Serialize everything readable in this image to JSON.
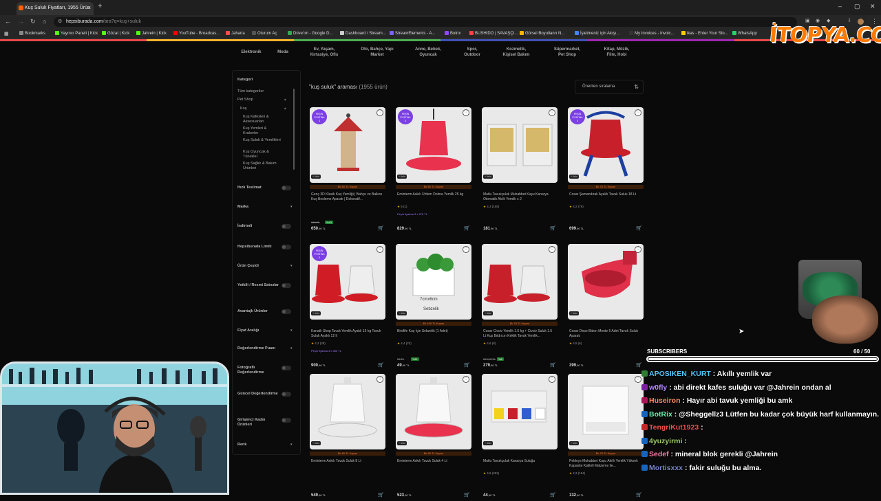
{
  "browser": {
    "tab_title": "Kuş Suluk Fiyatları, 1955 Ürün",
    "url_host": "hepsiburada.com",
    "url_path": "/ara?q=kuş+suluk",
    "bookmarks": [
      "Bookmarks",
      "Yayıncı Paneli | Kick",
      "Gözat | Kick",
      "Jahrein | Kick",
      "YouTube - Broadcas...",
      "Jaharia",
      "Oturum Aç",
      "Drive'ım - Google D...",
      "Dashboard / Stream...",
      "StreamElements - A...",
      "Botrix",
      "BUSHIDO | SAVAŞÇI...",
      "Görsel Boyutlanrı N...",
      "İşletmeniz için Akışı...",
      "My Invoices - Invoic...",
      "ikas - Enter Your Sto...",
      "WhatsApp"
    ]
  },
  "overlay": {
    "logo": "İTOPYA.COM"
  },
  "categories": [
    {
      "l1": "Elektronik",
      "l2": ""
    },
    {
      "l1": "Moda",
      "l2": ""
    },
    {
      "l1": "Ev, Yaşam,",
      "l2": "Kırtasiye, Ofis"
    },
    {
      "l1": "Oto, Bahçe, Yapı",
      "l2": "Market"
    },
    {
      "l1": "Anne, Bebek,",
      "l2": "Oyuncak"
    },
    {
      "l1": "Spor,",
      "l2": "Outdoor"
    },
    {
      "l1": "Kozmetik,",
      "l2": "Kişisel Bakım"
    },
    {
      "l1": "Süpermarket,",
      "l2": "Pet Shop"
    },
    {
      "l1": "Kitap, Müzik,",
      "l2": "Film, Hobi"
    }
  ],
  "sidebar": {
    "kategori": "Kategori",
    "tum": "Tüm kategoriler",
    "petshop": "Pet Shop",
    "kus": "Kuş",
    "sub": [
      "Kuş Kafesleri & Aksesuarları",
      "Kuş Yemleri & Krakerler",
      "Kuş Suluk & Yemlikleri",
      "Kuş Oyuncak & Tüneklel",
      "Kuş Sağlık & Bakım Ürünleri"
    ],
    "filters": [
      {
        "label": "Hızlı Teslimat",
        "type": "toggle"
      },
      {
        "label": "Marka",
        "type": "chev"
      },
      {
        "label": "İndirimli",
        "type": "toggle"
      },
      {
        "label": "Hepsiburada Limiti",
        "type": "toggle"
      },
      {
        "label": "Ürün Çeşidi",
        "type": "chev"
      },
      {
        "label": "Yetkili / Resmi Satıcılar",
        "type": "toggle"
      },
      {
        "label": "Avantajlı Ürünler",
        "type": "toggle"
      },
      {
        "label": "Fiyat Aralığı",
        "type": "chev"
      },
      {
        "label": "Değerlendirme Puanı",
        "type": "chev"
      },
      {
        "label": "Fotoğraflı Değerlendirme",
        "type": "toggle"
      },
      {
        "label": "Güncel Değerlendirme",
        "type": "toggle"
      },
      {
        "label": "Girişimci Kadın Ürünleri",
        "type": "toggle"
      },
      {
        "label": "Renk",
        "type": "chev"
      }
    ]
  },
  "results": {
    "query_title": "\"kuş suluk\" araması",
    "count": "(1955 ürün)",
    "sort_label": "Önerilen sıralama"
  },
  "products": [
    {
      "ribbon": true,
      "kupon": "Ek 50 TL Kupon",
      "name": "Genç 3D Klasik Kuş Yemliği | Bahçe ve Balkon Kuş Besleme Aparatı | Dekoratif...",
      "rating": "",
      "promo": "",
      "old": "769 TL",
      "disc": "%43",
      "price": "650",
      "color": "#c03030"
    },
    {
      "ribbon": true,
      "kupon": "Ek 60 TL Kupon",
      "name": "Eminterm Askılı Ürtlem Dolma Yemlik 25 kg",
      "rating": "5 (1)",
      "promo": "Peşin fiyatına 3 x 276 TL",
      "old": "",
      "disc": "",
      "price": "829",
      "color": "#e8324e"
    },
    {
      "ribbon": false,
      "kupon": "",
      "name": "Mutlu Tavukçuluk Muhabbet Kuşu Kanarya Otomatik Akıllı Yemlik x 2",
      "rating": "4,3 (158)",
      "promo": "",
      "old": "",
      "disc": "",
      "price": "181",
      "color": "#d8c28a"
    },
    {
      "ribbon": true,
      "kupon": "Ek 75 TL Kupon",
      "name": "Cosar Şamandıralı Ayaklı Tavuk Suluk 18 Lt",
      "rating": "4,2 (78)",
      "promo": "",
      "old": "",
      "disc": "",
      "price": "699",
      "color": "#c8202a"
    },
    {
      "ribbon": true,
      "kupon": "",
      "name": "Kanatlı Shop Tavuk Yemlik Ayaklı 15 kg Tavuk Suluk Ayaklı 12 lt",
      "rating": "4,3 (28)",
      "promo": "Peşin fiyatına 3 x 300 TL",
      "old": "",
      "disc": "",
      "price": "900",
      "color": "#d01c24"
    },
    {
      "ribbon": false,
      "kupon": "Ek 100 TL Kupon",
      "name": "Birdlife Kuş İçin Sebzelik (1 Adet)",
      "rating": "4,4 (23)",
      "promo": "",
      "old": "55 TL",
      "disc": "%11",
      "price": "49",
      "color": "#ffffff"
    },
    {
      "ribbon": false,
      "kupon": "Ek 75 TL Kupon",
      "name": "Cosar Civciv Yemlik 1.5 kg + Civciv Suluk 1.5 Lt Kuş Bıldırcın Keklik Tavuk Yemlik...",
      "rating": "4,6 (8)",
      "promo": "",
      "old": "299,90 TL",
      "disc": "%8",
      "price": "279",
      "color": "#c8202a"
    },
    {
      "ribbon": false,
      "kupon": "",
      "name": "Cosar Depo Bidon Monte 5 Adet Tavuk Suluk Aparatı",
      "rating": "4,5 (6)",
      "promo": "",
      "old": "",
      "disc": "",
      "price": "399",
      "color": "#e0304a"
    },
    {
      "ribbon": false,
      "kupon": "Ek 60 TL Kupon",
      "name": "Eminterm Askılı Tavuk Suluk 8 Lt",
      "rating": "",
      "promo": "",
      "old": "",
      "disc": "",
      "price": "549",
      "color": "#f4f4f4"
    },
    {
      "ribbon": false,
      "kupon": "Ek 60 TL Kupon",
      "name": "Eminterm Askılı Tavuk Suluk 4 Lt",
      "rating": "",
      "promo": "",
      "old": "",
      "disc": "",
      "price": "523",
      "color": "#f4f4f4"
    },
    {
      "ribbon": false,
      "kupon": "",
      "name": "Mutlu Tavukçuluk Kanarya Suluğu",
      "rating": "4,6 (292)",
      "promo": "",
      "old": "",
      "disc": "",
      "price": "44",
      "color": "#d8d8d8"
    },
    {
      "ribbon": false,
      "kupon": "Ek 75 TL Kupon",
      "name": "Peldoys Muhabbet Kuşu Akıllı Yemlik Yüksek Kapasite Kaliteli Malzeme ile...",
      "rating": "4,3 (154)",
      "promo": "",
      "old": "",
      "disc": "",
      "price": "132",
      "color": "#f2f2f2"
    }
  ],
  "subscribers": {
    "label": "SUBSCRIBERS",
    "current": 60,
    "goal": 50,
    "text": "60  / 50"
  },
  "chat": [
    {
      "user": "APOSIKEN_KURT",
      "color": "#4fc3f7",
      "text": " : Akıllı yemlik var"
    },
    {
      "user": "w0fly",
      "color": "#b388ff",
      "text": " : abi direkt kafes suluğu var @Jahrein ondan al"
    },
    {
      "user": "Huseiron",
      "color": "#ff8a65",
      "text": " : Hayır abi tavuk yemliği bu amk"
    },
    {
      "user": "BotRix",
      "color": "#69f0ae",
      "text": " : @Sheggellz3 Lütfen bu kadar çok büyük harf kullanmayın."
    },
    {
      "user": "TengriKut1923",
      "color": "#ef5350",
      "text": " : "
    },
    {
      "user": "4yuzyirmi",
      "color": "#9ccc65",
      "text": " : "
    },
    {
      "user": "Sedef",
      "color": "#ff80ab",
      "text": " : mineral blok gerekli @Jahrein"
    },
    {
      "user": "Mortisxxx",
      "color": "#7986cb",
      "text": " : fakir suluğu bu alma."
    }
  ]
}
